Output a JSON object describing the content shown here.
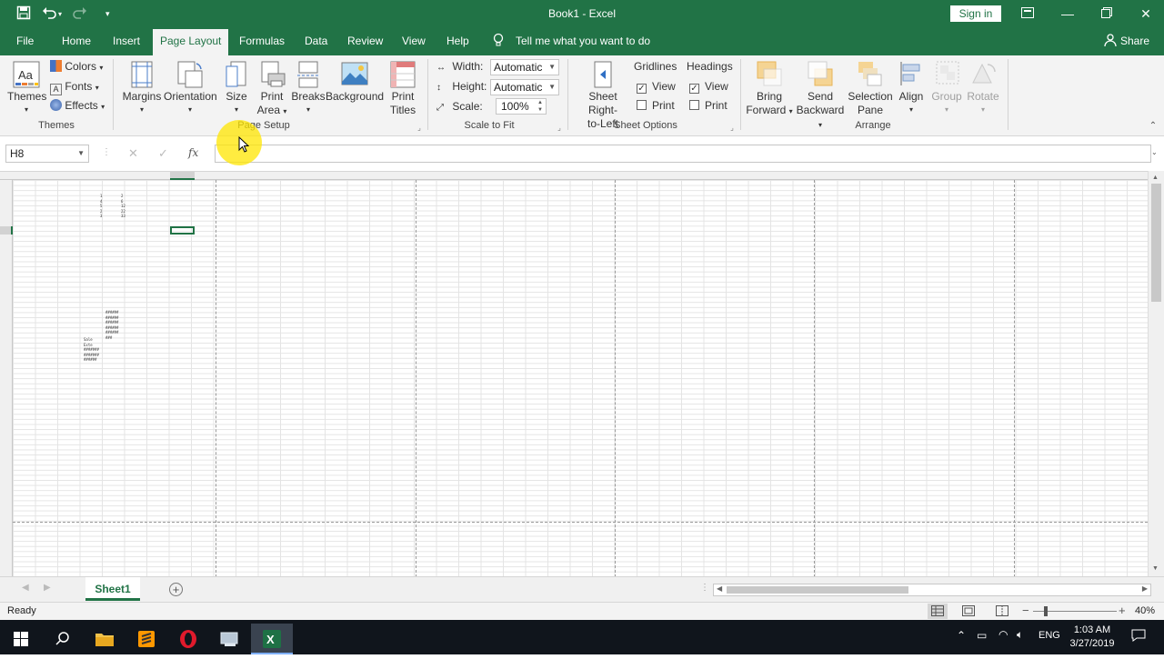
{
  "titlebar": {
    "title": "Book1  -  Excel",
    "signin": "Sign in"
  },
  "tabs": [
    {
      "label": "File"
    },
    {
      "label": "Home"
    },
    {
      "label": "Insert"
    },
    {
      "label": "Page Layout"
    },
    {
      "label": "Formulas"
    },
    {
      "label": "Data"
    },
    {
      "label": "Review"
    },
    {
      "label": "View"
    },
    {
      "label": "Help"
    }
  ],
  "tellme": "Tell me what you want to do",
  "share": "Share",
  "ribbon": {
    "themes": {
      "themes": "Themes",
      "colors": "Colors",
      "fonts": "Fonts",
      "effects": "Effects",
      "group": "Themes"
    },
    "page_setup": {
      "margins": "Margins",
      "orientation": "Orientation",
      "size": "Size",
      "print_area_1": "Print",
      "print_area_2": "Area",
      "breaks": "Breaks",
      "background": "Background",
      "print_titles_1": "Print",
      "print_titles_2": "Titles",
      "group": "Page Setup"
    },
    "scale_to_fit": {
      "width_label": "Width:",
      "width_value": "Automatic",
      "height_label": "Height:",
      "height_value": "Automatic",
      "scale_label": "Scale:",
      "scale_value": "100%",
      "group": "Scale to Fit"
    },
    "sheet_options": {
      "rtl_1": "Sheet Right-",
      "rtl_2": "to-Left",
      "gridlines": "Gridlines",
      "headings": "Headings",
      "view": "View",
      "print": "Print",
      "group": "Sheet Options"
    },
    "arrange": {
      "bring_1": "Bring",
      "bring_2": "Forward",
      "send_1": "Send",
      "send_2": "Backward",
      "sel_1": "Selection",
      "sel_2": "Pane",
      "align": "Align",
      "group_btn": "Group",
      "rotate": "Rotate",
      "group": "Arrange"
    }
  },
  "formula": {
    "namebox": "H8",
    "fx": "fx"
  },
  "sheet": {
    "tab": "Sheet1"
  },
  "status": {
    "ready": "Ready",
    "zoom": "40%"
  },
  "taskbar": {
    "time": "1:03 AM",
    "date": "3/27/2019",
    "lang": "ENG"
  },
  "colors": {
    "excel_green": "#217346"
  }
}
